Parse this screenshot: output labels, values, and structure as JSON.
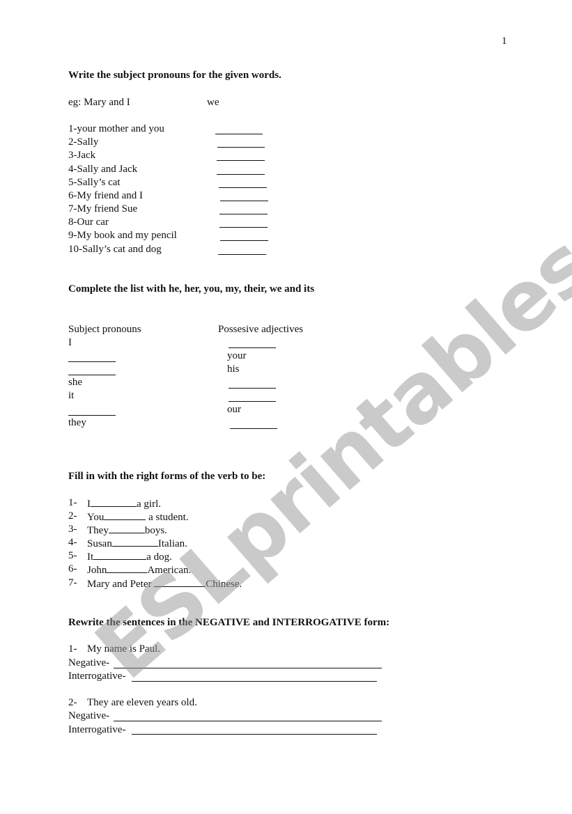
{
  "page_number": "1",
  "watermark": "ESLprintables.com",
  "section1": {
    "title": "Write the subject pronouns for the given words.",
    "example_label": "eg: Mary  and I",
    "example_answer": "we",
    "items": [
      "1-your mother and you",
      "2-Sally",
      "3-Jack",
      "4-Sally and Jack",
      "5-Sally’s cat",
      "6-My friend and I",
      "7-My friend Sue",
      "8-Our car",
      "9-My book and my pencil",
      "10-Sally’s cat and dog"
    ]
  },
  "section2": {
    "title": "Complete the  list with he, her, you, my, their, we and its",
    "col1_header": "Subject pronouns",
    "col2_header": "Possesive adjectives",
    "subject_pronouns": [
      "I",
      "",
      "",
      "she",
      "it",
      "",
      "they"
    ],
    "possessive_adjectives": [
      "",
      "your",
      "his",
      "",
      "",
      "our",
      ""
    ]
  },
  "section3": {
    "title": "Fill in with the right forms of the verb to be:",
    "items": [
      {
        "num": "1-",
        "before": "I",
        "after": "a girl."
      },
      {
        "num": "2-",
        "before": "You",
        "after": " a student."
      },
      {
        "num": "3-",
        "before": "They",
        "after": "boys."
      },
      {
        "num": "4-",
        "before": "Susan",
        "after": "Italian."
      },
      {
        "num": "5-",
        "before": "It",
        "after": "a dog."
      },
      {
        "num": "6-",
        "before": "John",
        "after": "American."
      },
      {
        "num": "7-",
        "before": "Mary and Peter ",
        "after": "Chinese."
      }
    ]
  },
  "section4": {
    "title": "Rewrite the sentences in the NEGATIVE and INTERROGATIVE form:",
    "items": [
      {
        "num": "1-",
        "sentence": "My name is Paul.",
        "negative_label": "Negative-",
        "interrogative_label": "Interrogative-"
      },
      {
        "num": "2-",
        "sentence": "They are eleven years old.",
        "negative_label": "Negative-",
        "interrogative_label": "Interrogative-"
      }
    ]
  }
}
